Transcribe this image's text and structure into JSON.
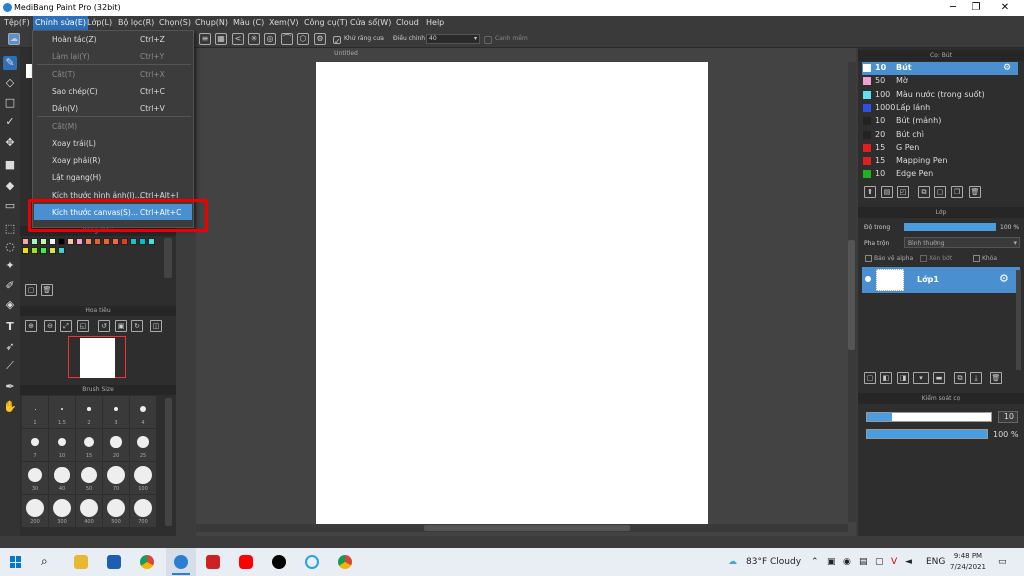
{
  "window": {
    "title": "MediBang Paint Pro (32bit)",
    "controls": [
      "─",
      "❐",
      "✕"
    ]
  },
  "menu": [
    "Tệp(F)",
    "Chỉnh sửa(E)",
    "Lớp(L)",
    "Bộ lọc(R)",
    "Chọn(S)",
    "Chụp(N)",
    "Màu (C)",
    "Xem(V)",
    "Công cụ(T)",
    "Cửa sổ(W)",
    "Cloud",
    "Help"
  ],
  "toolbar": {
    "antialias_label": "Khử răng cưa",
    "adjust_label": "Điều chỉnh",
    "adjust_value": "40",
    "smooth_label": "Canh mềm"
  },
  "canvas": {
    "title": "Untitled"
  },
  "edit_menu": [
    {
      "label": "Hoàn tác(Z)",
      "shortcut": "Ctrl+Z",
      "enabled": true
    },
    {
      "label": "Làm lại(Y)",
      "shortcut": "Ctrl+Y",
      "enabled": false
    },
    {
      "label": "Cắt(T)",
      "shortcut": "Ctrl+X",
      "enabled": false
    },
    {
      "label": "Sao chép(C)",
      "shortcut": "Ctrl+C",
      "enabled": true
    },
    {
      "label": "Dán(V)",
      "shortcut": "Ctrl+V",
      "enabled": true
    },
    {
      "label": "Cắt(M)",
      "shortcut": "",
      "enabled": false
    },
    {
      "label": "Xoay trái(L)",
      "shortcut": "",
      "enabled": true
    },
    {
      "label": "Xoay phải(R)",
      "shortcut": "",
      "enabled": true
    },
    {
      "label": "Lật ngang(H)",
      "shortcut": "",
      "enabled": true
    },
    {
      "label": "Kích thước hình ảnh(I)...",
      "shortcut": "Ctrl+Alt+I",
      "enabled": true
    },
    {
      "label": "Kích thước canvas(S)...",
      "shortcut": "Ctrl+Alt+C",
      "enabled": true,
      "highlighted": true
    }
  ],
  "left_panels": {
    "palette_title": "Bảng màu",
    "navigator_title": "Hoa tiêu",
    "brush_size_title": "Brush Size",
    "brush_sizes": [
      "1",
      "1.5",
      "2",
      "3",
      "4",
      "7",
      "10",
      "15",
      "20",
      "25",
      "30",
      "40",
      "50",
      "70",
      "100",
      "200",
      "300",
      "400",
      "500",
      "700"
    ]
  },
  "palette_colors": [
    "#f4a6a6",
    "#a6f4c6",
    "#c6f4a6",
    "#f4f4f4",
    "#000000",
    "#f4c6a6",
    "#f4a6c6",
    "#f48a6a",
    "#e86030",
    "#f06030",
    "#f06a4a",
    "#e83a1a",
    "#20c0c0",
    "#00c0d0",
    "#40e0e0",
    "#f0e000",
    "#a0e020",
    "#40f040",
    "#e0e040",
    "#40d0d0"
  ],
  "brushes_panel": {
    "title": "Cọ: Bút",
    "items": [
      {
        "size": "10",
        "name": "Bút",
        "color": "#ffffff",
        "selected": true
      },
      {
        "size": "50",
        "name": "Mờ",
        "color": "#f0a0d0"
      },
      {
        "size": "100",
        "name": "Màu nước (trong suốt)",
        "color": "#60e0f0"
      },
      {
        "size": "1000",
        "name": "Lấp lánh",
        "color": "#3050e0"
      },
      {
        "size": "10",
        "name": "Bút (mảnh)",
        "color": "#222222"
      },
      {
        "size": "20",
        "name": "Bút chì",
        "color": "#222222"
      },
      {
        "size": "15",
        "name": "G Pen",
        "color": "#e02020"
      },
      {
        "size": "15",
        "name": "Mapping Pen",
        "color": "#e02020"
      },
      {
        "size": "10",
        "name": "Edge Pen",
        "color": "#20b020"
      }
    ]
  },
  "layer_panel": {
    "title": "Lớp",
    "opacity_label": "Độ trong",
    "opacity_value": "100 %",
    "blend_label": "Pha trộn",
    "blend_value": "Bình thường",
    "protect_alpha": "Bảo vệ alpha",
    "clipping": "Xén bớt",
    "lock": "Khóa",
    "layer_name": "Lớp1"
  },
  "brush_control": {
    "title": "Kiểm soát cọ",
    "size_value": "10",
    "size_fraction": 0.2,
    "opacity_value": "100 %",
    "opacity_fraction": 1.0
  },
  "taskbar": {
    "weather": "83°F  Cloudy",
    "lang": "ENG",
    "time": "9:48 PM",
    "date": "7/24/2021"
  }
}
